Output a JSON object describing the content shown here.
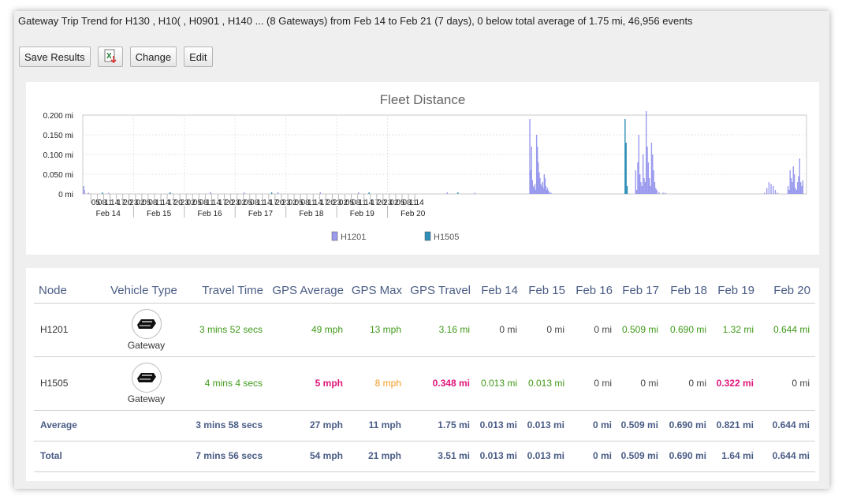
{
  "summary": {
    "text": "Gateway Trip Trend for H130          , H10(            , H0901       , H140        ... (8 Gateways) from Feb 14 to Feb 21 (7 days), 0 below total average of 1.75 mi, 46,956 events"
  },
  "toolbar": {
    "save_label": "Save Results",
    "export_icon": "excel-export-icon",
    "change_label": "Change",
    "edit_label": "Edit"
  },
  "chart_data": {
    "type": "bar",
    "title": "Fleet Distance",
    "y_ticks": [
      "0.200 mi",
      "0.150 mi",
      "0.100 mi",
      "0.050 mi",
      "0 mi"
    ],
    "ylim": [
      0,
      0.2
    ],
    "hour_ticks": [
      "05",
      "08",
      "11",
      "14",
      "17",
      "20",
      "23",
      "02",
      "05",
      "08",
      "11",
      "14",
      "17",
      "20",
      "23",
      "02",
      "05",
      "08",
      "11",
      "14",
      "17",
      "20",
      "23",
      "02",
      "05",
      "08",
      "11",
      "14",
      "17",
      "20",
      "23",
      "02",
      "05",
      "08",
      "11",
      "14",
      "17",
      "20",
      "23",
      "02",
      "05",
      "08",
      "11",
      "14",
      "17",
      "20",
      "23",
      "02",
      "05",
      "08",
      "11",
      "14"
    ],
    "day_labels": [
      "Feb 14",
      "Feb 15",
      "Feb 16",
      "Feb 17",
      "Feb 18",
      "Feb 19",
      "Feb 20"
    ],
    "grid": true,
    "legend_placement": "bottom",
    "series": [
      {
        "name": "H1201",
        "color": "#9a9aee",
        "points": [
          [
            0.2,
            0.02
          ],
          [
            0.5,
            0.01
          ],
          [
            2.5,
            0.003
          ],
          [
            12,
            0.003
          ],
          [
            60,
            0.005
          ],
          [
            76,
            0.004
          ],
          [
            92,
            0.004
          ],
          [
            112,
            0.004
          ],
          [
            130,
            0.004
          ],
          [
            172,
            0.004
          ],
          [
            185,
            0.003
          ],
          [
            211.0,
            0.19
          ],
          [
            211.4,
            0.06
          ],
          [
            211.8,
            0.12
          ],
          [
            212.2,
            0.035
          ],
          [
            212.6,
            0.02
          ],
          [
            213.0,
            0.015
          ],
          [
            213.4,
            0.025
          ],
          [
            213.8,
            0.01
          ],
          [
            214.2,
            0.15
          ],
          [
            214.6,
            0.12
          ],
          [
            215.0,
            0.08
          ],
          [
            215.4,
            0.055
          ],
          [
            215.8,
            0.04
          ],
          [
            216.2,
            0.025
          ],
          [
            216.6,
            0.02
          ],
          [
            217.0,
            0.03
          ],
          [
            217.4,
            0.015
          ],
          [
            217.8,
            0.05
          ],
          [
            218.2,
            0.04
          ],
          [
            218.6,
            0.02
          ],
          [
            219.0,
            0.01
          ],
          [
            219.4,
            0.015
          ],
          [
            219.8,
            0.008
          ],
          [
            220.2,
            0.005
          ],
          [
            221,
            0.003
          ],
          [
            261.0,
            0.06
          ],
          [
            261.5,
            0.01
          ],
          [
            262.0,
            0.08
          ],
          [
            262.5,
            0.15
          ],
          [
            263.0,
            0.05
          ],
          [
            263.5,
            0.03
          ],
          [
            264.0,
            0.02
          ],
          [
            264.5,
            0.1
          ],
          [
            265.0,
            0.04
          ],
          [
            265.5,
            0.03
          ],
          [
            266.0,
            0.21
          ],
          [
            266.5,
            0.12
          ],
          [
            267.0,
            0.08
          ],
          [
            267.5,
            0.04
          ],
          [
            268.0,
            0.02
          ],
          [
            268.5,
            0.13
          ],
          [
            269.0,
            0.1
          ],
          [
            269.5,
            0.06
          ],
          [
            270.0,
            0.03
          ],
          [
            270.5,
            0.015
          ],
          [
            271.0,
            0.01
          ],
          [
            272,
            0.005
          ],
          [
            274,
            0.003
          ],
          [
            275,
            0.003
          ],
          [
            322,
            0.003
          ],
          [
            323,
            0.015
          ],
          [
            324,
            0.03
          ],
          [
            325,
            0.025
          ],
          [
            326,
            0.02
          ],
          [
            327,
            0.01
          ],
          [
            328,
            0.003
          ],
          [
            333.0,
            0.02
          ],
          [
            333.5,
            0.01
          ],
          [
            334.0,
            0.06
          ],
          [
            334.5,
            0.04
          ],
          [
            335.0,
            0.03
          ],
          [
            335.5,
            0.07
          ],
          [
            336.0,
            0.05
          ],
          [
            336.5,
            0.015
          ],
          [
            337.0,
            0.01
          ],
          [
            337.5,
            0.03
          ],
          [
            338.0,
            0.045
          ],
          [
            338.5,
            0.09
          ],
          [
            339.0,
            0.03
          ],
          [
            339.5,
            0.02
          ],
          [
            340.0,
            0.035
          ]
        ]
      },
      {
        "name": "H1505",
        "color": "#2f8fb8",
        "points": [
          [
            9,
            0.004
          ],
          [
            41,
            0.004
          ],
          [
            89,
            0.004
          ],
          [
            135,
            0.004
          ],
          [
            177,
            0.004
          ],
          [
            256.0,
            0.19
          ],
          [
            256.5,
            0.13
          ],
          [
            257.0,
            0.02
          ]
        ]
      }
    ]
  },
  "table": {
    "columns": [
      "Node",
      "Vehicle Type",
      "Travel Time",
      "GPS Average",
      "GPS Max",
      "GPS Travel",
      "Feb 14",
      "Feb 15",
      "Feb 16",
      "Feb 17",
      "Feb 18",
      "Feb 19",
      "Feb 20"
    ],
    "rows": [
      {
        "node": "H1201",
        "vehicle_type": "Gateway",
        "vehicle_icon": "gateway-vehicle-icon",
        "travel_time": "3 mins 52 secs",
        "gps_average": "49 mph",
        "gps_max": "13 mph",
        "gps_travel": "3.16 mi",
        "days": [
          "0 mi",
          "0 mi",
          "0 mi",
          "0.509 mi",
          "0.690 mi",
          "1.32 mi",
          "0.644 mi"
        ]
      },
      {
        "node": "H1505",
        "vehicle_type": "Gateway",
        "vehicle_icon": "gateway-vehicle-icon",
        "travel_time": "4 mins 4 secs",
        "gps_average": "5 mph",
        "gps_max": "8 mph",
        "gps_travel": "0.348 mi",
        "days": [
          "0.013 mi",
          "0.013 mi",
          "0 mi",
          "0 mi",
          "0 mi",
          "0.322 mi",
          "0 mi"
        ]
      }
    ],
    "average": {
      "label": "Average",
      "travel_time": "3 mins 58 secs",
      "gps_average": "27 mph",
      "gps_max": "11 mph",
      "gps_travel": "1.75 mi",
      "days": [
        "0.013 mi",
        "0.013 mi",
        "0 mi",
        "0.509 mi",
        "0.690 mi",
        "0.821 mi",
        "0.644 mi"
      ]
    },
    "total": {
      "label": "Total",
      "travel_time": "7 mins 56 secs",
      "gps_average": "54 mph",
      "gps_max": "21 mph",
      "gps_travel": "3.51 mi",
      "days": [
        "0.013 mi",
        "0.013 mi",
        "0 mi",
        "0.509 mi",
        "0.690 mi",
        "1.64 mi",
        "0.644 mi"
      ]
    }
  },
  "colors": {
    "header_text": "#4a5c85",
    "good": "#3f9a19",
    "bad": "#e0157a",
    "warn": "#f09a21"
  }
}
